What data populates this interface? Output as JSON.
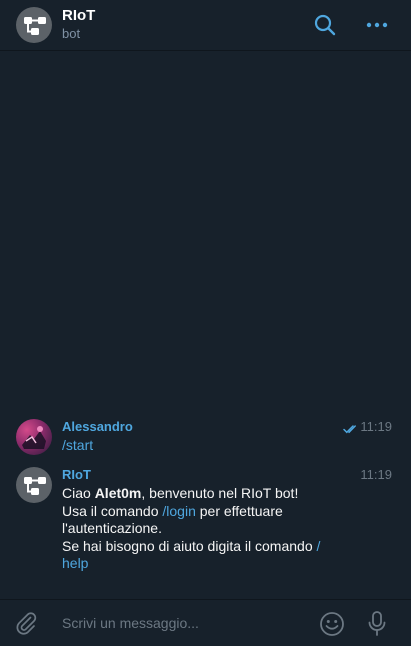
{
  "header": {
    "title": "RIoT",
    "subtitle": "bot",
    "search_icon": "search-icon",
    "menu_icon": "more-horizontal-icon"
  },
  "messages": [
    {
      "sender": "Alessandro",
      "time": "11:19",
      "status": "read-double-check",
      "command": "/start"
    },
    {
      "sender": "RIoT",
      "time": "11:19",
      "line1_pre": "Ciao ",
      "line1_name": "Alet0m",
      "line1_post": ", benvenuto nel RIoT bot!",
      "line2_pre": "Usa il comando ",
      "line2_link": "/login",
      "line2_post": " per effettuare",
      "line3": "l'autenticazione.",
      "line4_pre": "Se hai bisogno di aiuto digita il comando ",
      "line4_link1": "/",
      "line5_link2": "help"
    }
  ],
  "composer": {
    "placeholder": "Scrivi un messaggio...",
    "attach_icon": "paperclip-icon",
    "emoji_icon": "emoji-icon",
    "mic_icon": "microphone-icon"
  },
  "colors": {
    "background": "#17212b",
    "accent": "#4fa7df",
    "muted": "#6c7883"
  }
}
